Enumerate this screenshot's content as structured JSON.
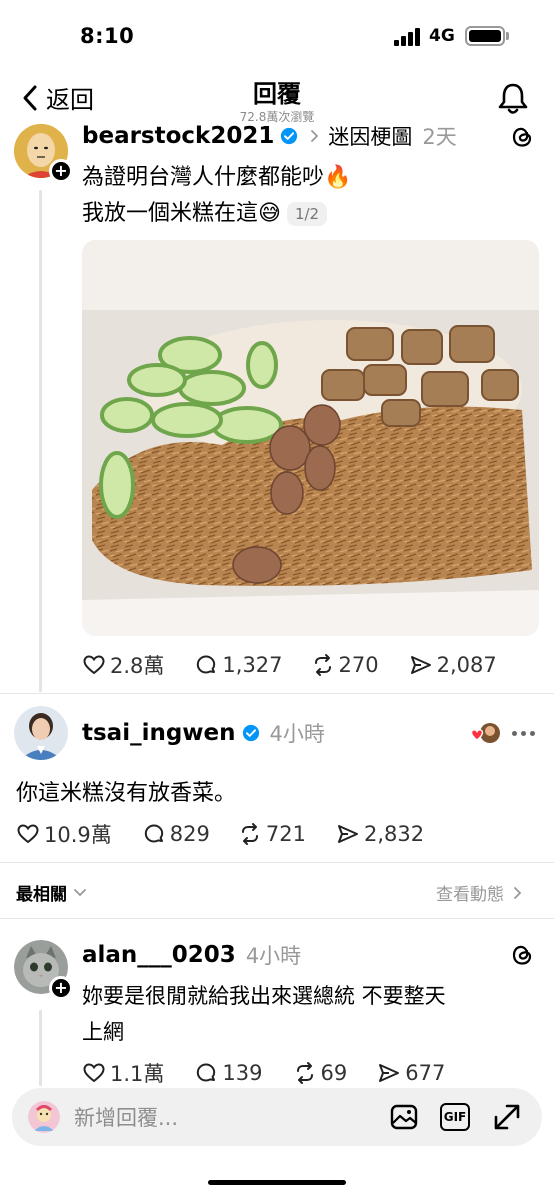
{
  "status_bar": {
    "time": "8:10",
    "network": "4G"
  },
  "header": {
    "back_label": "返回",
    "title": "回覆",
    "views": "72.8萬次瀏覽"
  },
  "post": {
    "username": "bearstock2021",
    "topic": "迷因梗圖",
    "time": "2天",
    "line1": "為證明台灣人什麼都能吵🔥",
    "line2": "我放一個米糕在這😅",
    "image_counter": "1/2",
    "likes": "2.8萬",
    "comments": "1,327",
    "reposts": "270",
    "shares": "2,087"
  },
  "reply": {
    "username": "tsai_ingwen",
    "time": "4小時",
    "text": "你這米糕沒有放香菜。",
    "likes": "10.9萬",
    "comments": "829",
    "reposts": "721",
    "shares": "2,832"
  },
  "sort": {
    "label": "最相關",
    "activity": "查看動態"
  },
  "comment": {
    "username": "alan___0203",
    "time": "4小時",
    "text_line1": "妳要是很閒就給我出來選總統 不要整天",
    "text_line2": "上網",
    "likes": "1.1萬",
    "comments": "139",
    "reposts": "69",
    "shares": "677"
  },
  "composer": {
    "placeholder": "新增回覆...",
    "gif_label": "GIF"
  },
  "colors": {
    "verified_blue": "#0095f6",
    "muted": "#999999",
    "heart_red": "#ff3040"
  }
}
